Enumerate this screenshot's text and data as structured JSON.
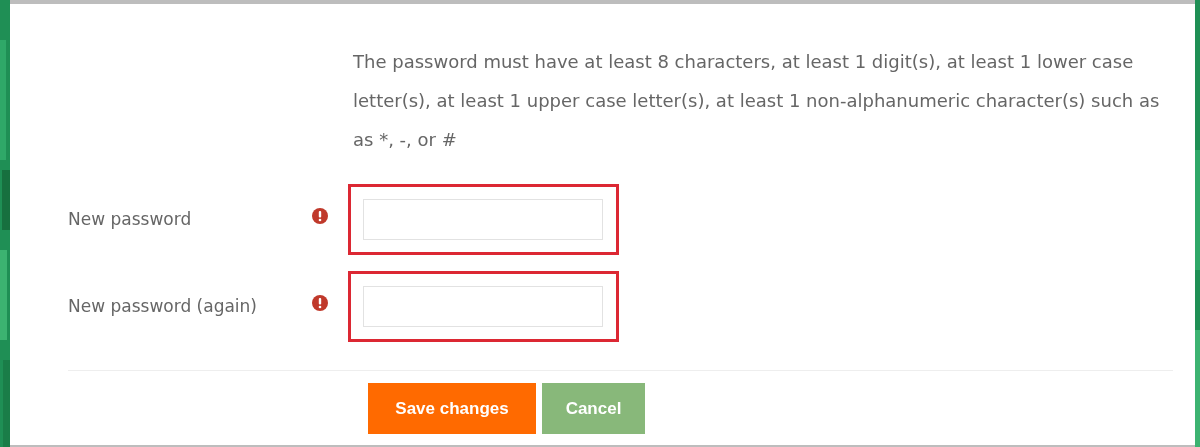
{
  "form": {
    "requirements": "The password must have at least 8 characters, at least 1 digit(s), at least 1 lower case letter(s), at least 1 upper case letter(s), at least 1 non-alphanumeric character(s) such as as *, -, or #",
    "fields": [
      {
        "label": "New password",
        "required": true,
        "invalid": true
      },
      {
        "label": "New password (again)",
        "required": true,
        "invalid": true
      }
    ],
    "buttons": [
      {
        "label": "Save changes",
        "kind": "primary"
      },
      {
        "label": "Cancel",
        "kind": "secondary"
      }
    ]
  }
}
